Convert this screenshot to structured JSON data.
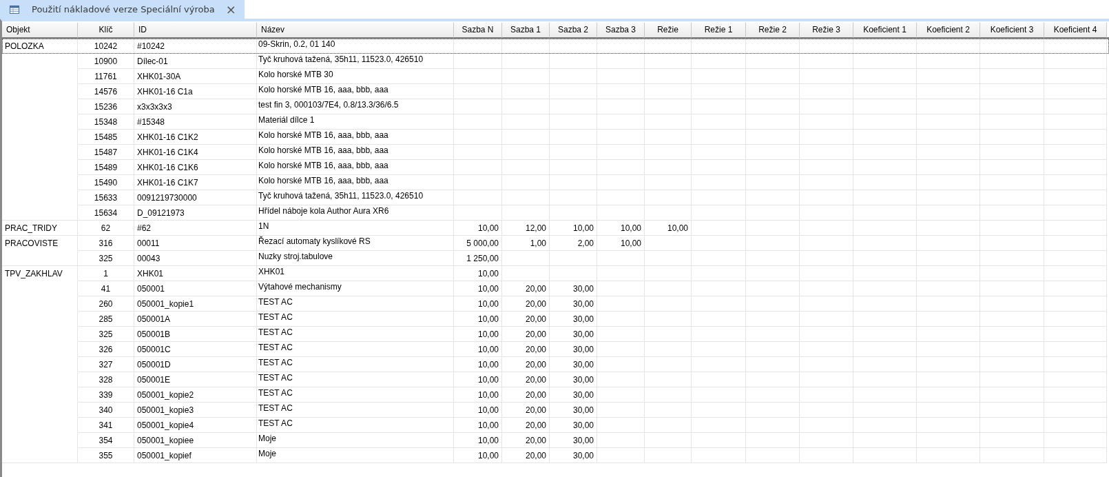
{
  "tab": {
    "title": "Použití nákladové verze Speciální výroba",
    "close": "×",
    "selected": true
  },
  "columns": [
    "Objekt",
    "Klíč",
    "ID",
    "Název",
    "Sazba N",
    "Sazba 1",
    "Sazba 2",
    "Sazba 3",
    "Režie",
    "Režie 1",
    "Režie 2",
    "Režie 3",
    "Koeficient 1",
    "Koeficient 2",
    "Koeficient 3",
    "Koeficient 4"
  ],
  "groups": [
    {
      "objekt": "POLOZKA",
      "rows": [
        {
          "klic": "10242",
          "id": "#10242",
          "nazev": "09-Skrin, 0.2, 01 140",
          "selected": true,
          "values": []
        },
        {
          "klic": "10900",
          "id": "Dílec-01",
          "nazev": "Tyč kruhová tažená, 35h11, 11523.0, 426510",
          "selected": false,
          "values": []
        },
        {
          "klic": "11761",
          "id": "XHK01-30A",
          "nazev": "Kolo horské MTB 30",
          "selected": false,
          "values": []
        },
        {
          "klic": "14576",
          "id": "XHK01-16 C1a",
          "nazev": "Kolo horské MTB 16, aaa, bbb, aaa",
          "selected": false,
          "values": []
        },
        {
          "klic": "15236",
          "id": "x3x3x3x3",
          "nazev": "test fin 3, 000103/7E4, 0.8/13.3/36/6.5",
          "selected": false,
          "values": []
        },
        {
          "klic": "15348",
          "id": "#15348",
          "nazev": "Materiál dílce 1",
          "selected": false,
          "values": []
        },
        {
          "klic": "15485",
          "id": "XHK01-16 C1K2",
          "nazev": "Kolo horské MTB 16, aaa, bbb, aaa",
          "selected": false,
          "values": []
        },
        {
          "klic": "15487",
          "id": "XHK01-16 C1K4",
          "nazev": "Kolo horské MTB 16, aaa, bbb, aaa",
          "selected": false,
          "values": []
        },
        {
          "klic": "15489",
          "id": "XHK01-16 C1K6",
          "nazev": "Kolo horské MTB 16, aaa, bbb, aaa",
          "selected": false,
          "values": []
        },
        {
          "klic": "15490",
          "id": "XHK01-16 C1K7",
          "nazev": "Kolo horské MTB 16, aaa, bbb, aaa",
          "selected": false,
          "values": []
        },
        {
          "klic": "15633",
          "id": "0091219730000",
          "nazev": "Tyč kruhová tažená, 35h11, 11523.0, 426510",
          "selected": false,
          "values": []
        },
        {
          "klic": "15634",
          "id": "D_09121973",
          "nazev": "Hřídel náboje kola Author Aura XR6",
          "selected": false,
          "values": []
        }
      ]
    },
    {
      "objekt": "PRAC_TRIDY",
      "rows": [
        {
          "klic": "62",
          "id": "#62",
          "nazev": "1N",
          "selected": false,
          "values": [
            "10,00",
            "12,00",
            "10,00",
            "10,00",
            "10,00"
          ]
        }
      ]
    },
    {
      "objekt": "PRACOVISTE",
      "rows": [
        {
          "klic": "316",
          "id": "00011",
          "nazev": "Řezací automaty kyslíkové RS",
          "selected": false,
          "values": [
            "5 000,00",
            "1,00",
            "2,00",
            "10,00"
          ]
        },
        {
          "klic": "325",
          "id": "00043",
          "nazev": "Nuzky stroj.tabulove",
          "selected": false,
          "values": [
            "1 250,00"
          ]
        }
      ]
    },
    {
      "objekt": "TPV_ZAKHLAV",
      "rows": [
        {
          "klic": "1",
          "id": "XHK01",
          "nazev": "XHK01",
          "selected": false,
          "values": [
            "10,00"
          ]
        },
        {
          "klic": "41",
          "id": "050001",
          "nazev": "Výtahové mechanismy",
          "selected": false,
          "values": [
            "10,00",
            "20,00",
            "30,00"
          ]
        },
        {
          "klic": "260",
          "id": "050001_kopie1",
          "nazev": "TEST AC",
          "selected": false,
          "values": [
            "10,00",
            "20,00",
            "30,00"
          ]
        },
        {
          "klic": "285",
          "id": "050001A",
          "nazev": "TEST AC",
          "selected": false,
          "values": [
            "10,00",
            "20,00",
            "30,00"
          ]
        },
        {
          "klic": "325",
          "id": "050001B",
          "nazev": "TEST AC",
          "selected": false,
          "values": [
            "10,00",
            "20,00",
            "30,00"
          ]
        },
        {
          "klic": "326",
          "id": "050001C",
          "nazev": "TEST AC",
          "selected": false,
          "values": [
            "10,00",
            "20,00",
            "30,00"
          ]
        },
        {
          "klic": "327",
          "id": "050001D",
          "nazev": "TEST AC",
          "selected": false,
          "values": [
            "10,00",
            "20,00",
            "30,00"
          ]
        },
        {
          "klic": "328",
          "id": "050001E",
          "nazev": "TEST AC",
          "selected": false,
          "values": [
            "10,00",
            "20,00",
            "30,00"
          ]
        },
        {
          "klic": "339",
          "id": "050001_kopie2",
          "nazev": "TEST AC",
          "selected": false,
          "values": [
            "10,00",
            "20,00",
            "30,00"
          ]
        },
        {
          "klic": "340",
          "id": "050001_kopie3",
          "nazev": "TEST AC",
          "selected": false,
          "values": [
            "10,00",
            "20,00",
            "30,00"
          ]
        },
        {
          "klic": "341",
          "id": "050001_kopie4",
          "nazev": "TEST AC",
          "selected": false,
          "values": [
            "10,00",
            "20,00",
            "30,00"
          ]
        },
        {
          "klic": "354",
          "id": "050001_kopiee",
          "nazev": "Moje",
          "selected": false,
          "values": [
            "10,00",
            "20,00",
            "30,00"
          ]
        },
        {
          "klic": "355",
          "id": "050001_kopief",
          "nazev": "Moje",
          "selected": false,
          "values": [
            "10,00",
            "20,00",
            "30,00"
          ]
        }
      ]
    }
  ]
}
